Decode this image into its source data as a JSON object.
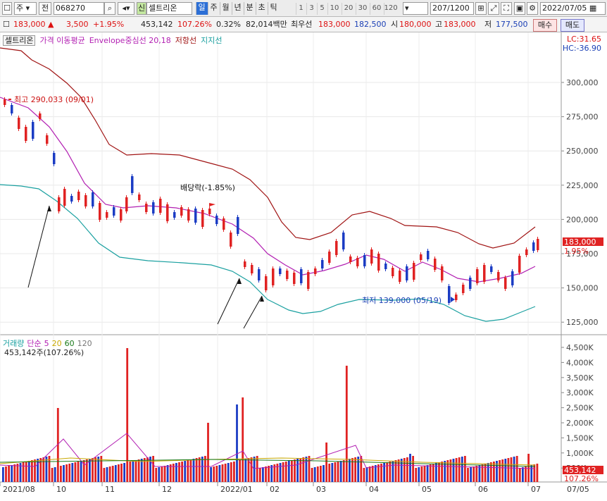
{
  "toolbar": {
    "market": "주",
    "market2": "전",
    "code": "068270",
    "stock_name": "셀트리온",
    "badge": "신",
    "periods": [
      "일",
      "주",
      "월",
      "년",
      "분",
      "초",
      "틱"
    ],
    "active_period": "일",
    "numbers": [
      "1",
      "3",
      "5",
      "10",
      "20",
      "30",
      "60",
      "120"
    ],
    "count": "207",
    "total": "/1200",
    "date": "2022/07/05"
  },
  "info": {
    "price": "183,000",
    "change": "3,500",
    "rate": "+1.95%",
    "volume": "453,142",
    "vol_rate": "107.26%",
    "turnover_rate": "0.32%",
    "amount": "82,014백만",
    "best_label": "최우선",
    "best_ask": "183,000",
    "best_bid": "182,500",
    "open_label": "시",
    "open": "180,000",
    "high_label": "고",
    "high": "183,000",
    "low_label": "저",
    "low": "177,500",
    "buy": "매수",
    "sell": "매도"
  },
  "legend": {
    "name": "셀트리온",
    "ma": "가격 이동평균",
    "envelope": "Envelope중심선 20,18",
    "resist": "저항선",
    "support": "지지선",
    "lc": "LC:31.65",
    "hc": "HC:-36.90"
  },
  "vlegend": {
    "name": "거래량",
    "ma": "단순",
    "p1": "5",
    "p2": "20",
    "p3": "60",
    "p4": "120",
    "sub": "453,142주(107.26%)"
  },
  "annotations": {
    "high": "최고 290,033 (09/01)",
    "low": "최저 139,000 (05/19)",
    "dividend": "배당락(-1.85%)"
  },
  "price_axis": [
    "300,000",
    "275,000",
    "250,000",
    "225,000",
    "200,000",
    "175,000",
    "150,000",
    "125,000"
  ],
  "vol_axis": [
    "4,500K",
    "4,000K",
    "3,500K",
    "3,000K",
    "2,500K",
    "2,000K",
    "1,500K",
    "1,000K",
    "500K"
  ],
  "date_axis": [
    "2021/08",
    "10",
    "11",
    "12",
    "2022/01",
    "02",
    "03",
    "04",
    "05",
    "06",
    "07",
    "07/05"
  ],
  "price_tag": {
    "value": "183,000",
    "rate": "1.95%"
  },
  "vol_tag": {
    "value": "453,142",
    "rate": "107.26%"
  },
  "colors": {
    "up": "#e02222",
    "down": "#1b3cc4",
    "ma": "#b21fb2",
    "resist": "#a01313",
    "support": "#1aa0a0"
  }
}
